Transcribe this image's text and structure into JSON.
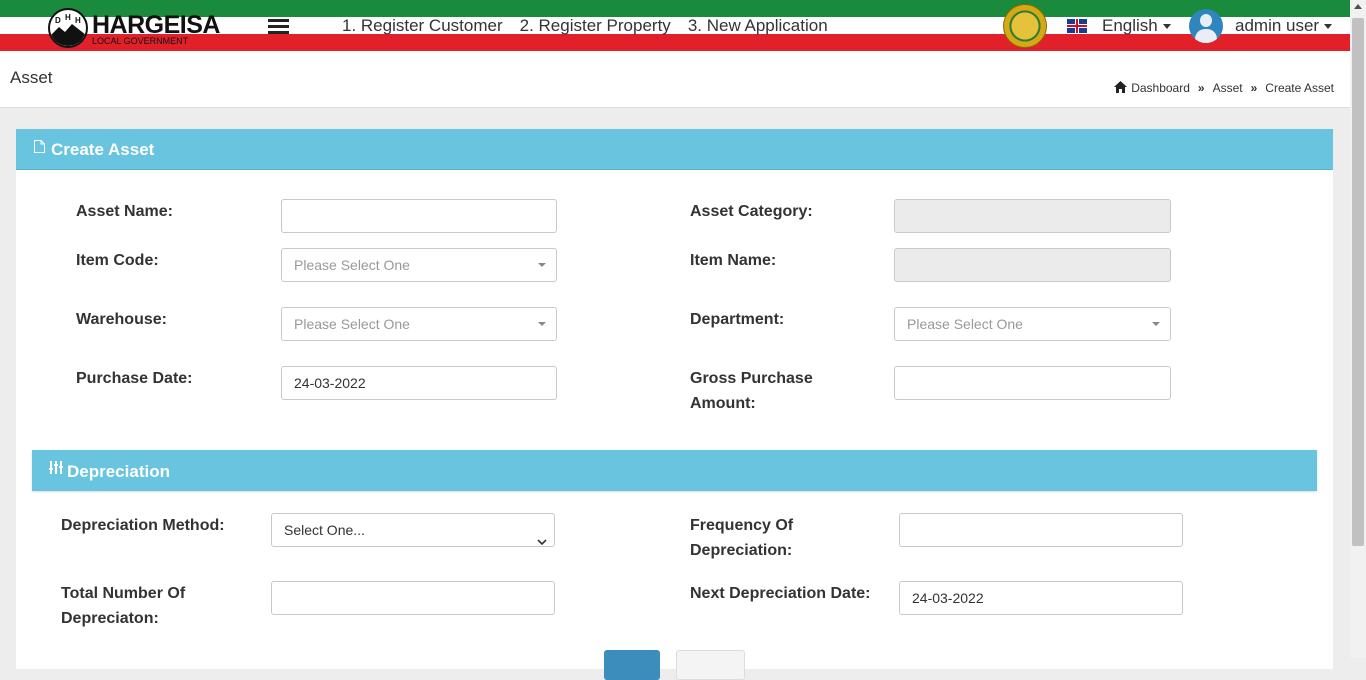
{
  "header": {
    "logo": {
      "title": "HARGEISA",
      "subtitle": "LOCAL GOVERNMENT"
    },
    "nav": [
      "1. Register Customer",
      "2. Register Property",
      "3. New Application"
    ],
    "language": "English",
    "user": "admin user"
  },
  "page": {
    "title": "Asset",
    "breadcrumb": [
      "Dashboard",
      "Asset",
      "Create Asset"
    ]
  },
  "form": {
    "card_title": "Create Asset",
    "fields": {
      "asset_name": {
        "label": "Asset Name:",
        "value": ""
      },
      "asset_category": {
        "label": "Asset Category:",
        "value": ""
      },
      "item_code": {
        "label": "Item Code:",
        "placeholder": "Please Select One"
      },
      "item_name": {
        "label": "Item Name:",
        "value": ""
      },
      "warehouse": {
        "label": "Warehouse:",
        "placeholder": "Please Select One"
      },
      "department": {
        "label": "Department:",
        "placeholder": "Please Select One"
      },
      "purchase_date": {
        "label": "Purchase Date:",
        "value": "24-03-2022"
      },
      "gross_purchase_amount": {
        "label_line1": "Gross Purchase",
        "label_line2": "Amount:",
        "value": ""
      }
    }
  },
  "depreciation": {
    "title": "Depreciation",
    "method": {
      "label": "Depreciation Method:",
      "value": "Select One..."
    },
    "frequency": {
      "label_line1": "Frequency Of",
      "label_line2": "Depreciation:",
      "value": ""
    },
    "total_number": {
      "label_line1": "Total Number Of",
      "label_line2": "Depreciaton:",
      "value": ""
    },
    "next_date": {
      "label": "Next Depreciation Date:",
      "value": "24-03-2022"
    }
  },
  "colors": {
    "accent": "#68c4df",
    "header_green": "#1a8a3c",
    "header_red": "#e2202a",
    "primary_button": "#3c8dbc"
  },
  "icons": [
    "hargeisa-logo-icon",
    "menu-icon",
    "emblem-icon",
    "uk-flag-icon",
    "avatar-icon",
    "home-icon",
    "document-icon",
    "sliders-icon",
    "chevron-down-icon"
  ]
}
